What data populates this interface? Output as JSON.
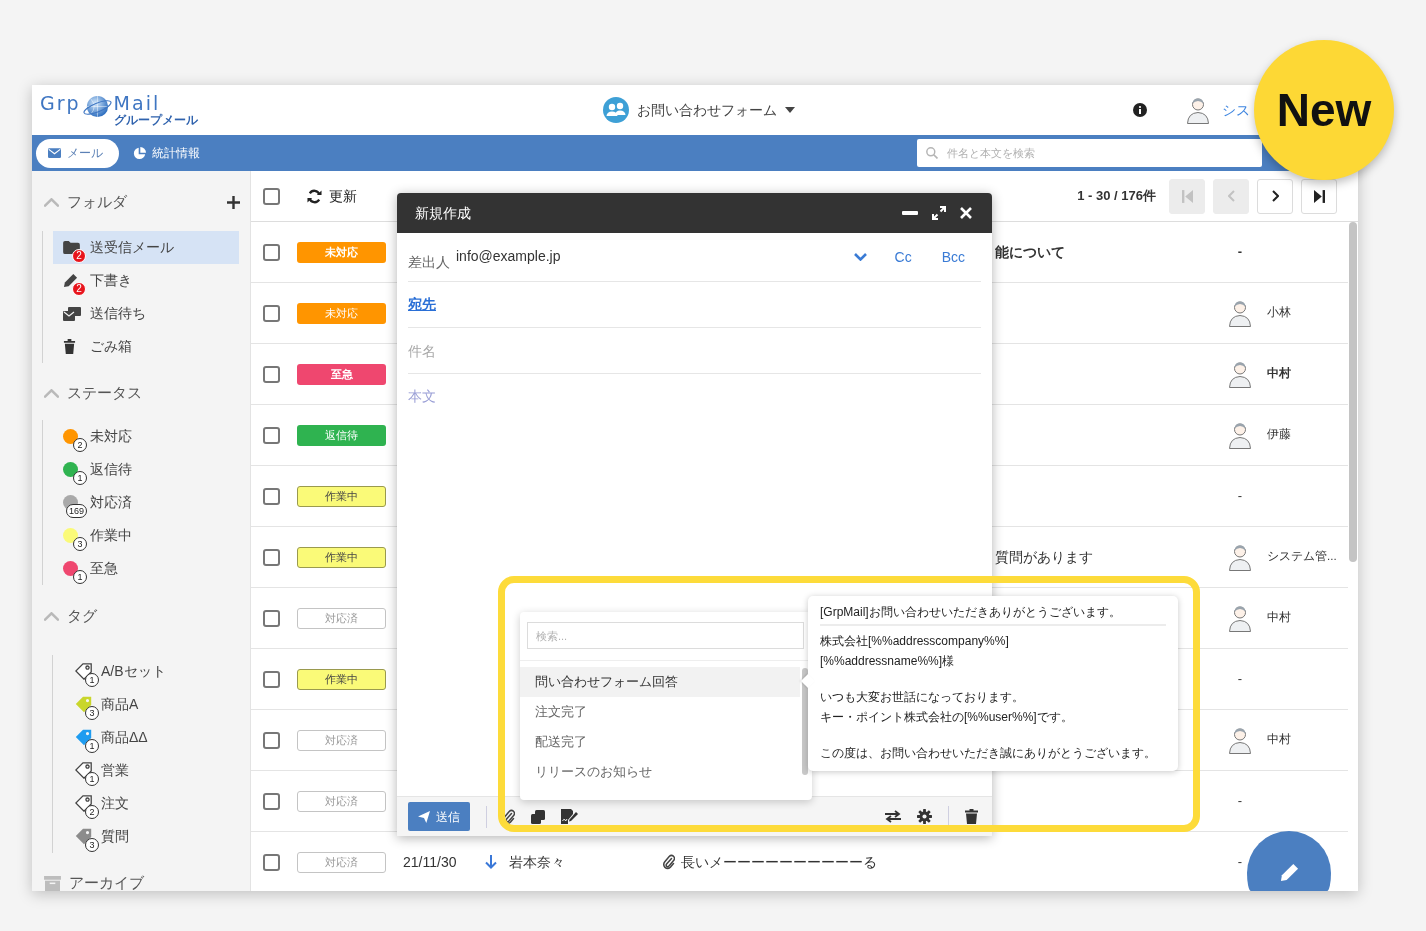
{
  "header": {
    "logo": {
      "left": "Grp",
      "right": "Mail",
      "subtitle": "グループメール"
    },
    "form_selector": {
      "label": "お問い合わせフォーム"
    },
    "user": {
      "name": "シス"
    }
  },
  "nav": {
    "tabs": [
      {
        "label": "メール",
        "kind": "mail",
        "selected": true
      },
      {
        "label": "統計情報",
        "kind": "stats",
        "selected": false
      }
    ],
    "search": {
      "placeholder": "件名と本文を検索"
    }
  },
  "sidebar": {
    "folders": {
      "title": "フォルダ",
      "expanded": true,
      "items": [
        {
          "label": "送受信メール",
          "kind": "inbox",
          "badge": "2",
          "selected": true
        },
        {
          "label": "下書き",
          "kind": "draft",
          "badge": "2",
          "selected": false
        },
        {
          "label": "送信待ち",
          "kind": "outbox",
          "selected": false
        },
        {
          "label": "ごみ箱",
          "kind": "trash",
          "selected": false
        }
      ]
    },
    "statuses": {
      "title": "ステータス",
      "expanded": true,
      "items": [
        {
          "label": "未対応",
          "color": "#ff9500",
          "count": "2",
          "selected": false
        },
        {
          "label": "返信待",
          "color": "#2fb350",
          "count": "1",
          "selected": false
        },
        {
          "label": "対応済",
          "color": "#a9a9a9",
          "count": "169",
          "selected": false
        },
        {
          "label": "作業中",
          "color": "#fafa78",
          "count": "3",
          "selected": false
        },
        {
          "label": "至急",
          "color": "#ef476f",
          "count": "1",
          "selected": false
        }
      ]
    },
    "tags": {
      "title": "タグ",
      "expanded": true,
      "items": [
        {
          "label": "A/Bセット",
          "color": "#ffffff",
          "count": "1",
          "selected": false
        },
        {
          "label": "商品A",
          "color": "#c9d62b",
          "count": "3",
          "selected": false
        },
        {
          "label": "商品ΔΔ",
          "color": "#1f9cf0",
          "count": "1",
          "selected": false
        },
        {
          "label": "営業",
          "color": "#ffffff",
          "count": "1",
          "selected": false
        },
        {
          "label": "注文",
          "color": "#ffffff",
          "count": "2",
          "selected": false
        },
        {
          "label": "質問",
          "color": "#8c8c8c",
          "count": "3",
          "selected": false
        }
      ]
    },
    "archive": {
      "label": "アーカイブ"
    }
  },
  "toolbar": {
    "select_all": {
      "checked": false
    },
    "refresh": {
      "label": "更新"
    },
    "pagination": {
      "range": "1 - 30 / 176件",
      "buttons": [
        {
          "kind": "first",
          "disabled": true
        },
        {
          "kind": "prev",
          "disabled": true
        },
        {
          "kind": "next",
          "disabled": false
        },
        {
          "kind": "last",
          "disabled": false
        }
      ]
    }
  },
  "rows": [
    {
      "checked": false,
      "unread": true,
      "status": {
        "label": "未対応",
        "color": "#ff9500"
      },
      "subject": "能について",
      "assignee": {
        "kind": "none",
        "name": "-"
      }
    },
    {
      "checked": false,
      "unread": false,
      "status": {
        "label": "未対応",
        "color": "#ff9500"
      },
      "assignee": {
        "kind": "person",
        "name": "小林"
      }
    },
    {
      "checked": false,
      "unread": true,
      "status": {
        "label": "至急",
        "color": "#ef476f"
      },
      "assignee": {
        "kind": "person",
        "name": "中村"
      }
    },
    {
      "checked": false,
      "unread": false,
      "status": {
        "label": "返信待",
        "color": "#2fb350"
      },
      "assignee": {
        "kind": "person",
        "name": "伊藤"
      }
    },
    {
      "checked": false,
      "unread": false,
      "status": {
        "label": "作業中",
        "color": "#fafa78"
      },
      "assignee": {
        "kind": "none",
        "name": "-"
      }
    },
    {
      "checked": false,
      "unread": false,
      "status": {
        "label": "作業中",
        "color": "#fafa78"
      },
      "subject": "質問があります",
      "assignee": {
        "kind": "person",
        "name": "システム管..."
      }
    },
    {
      "checked": false,
      "unread": false,
      "status": {
        "label": "対応済",
        "color": "#ffffff"
      },
      "assignee": {
        "kind": "person",
        "name": "中村"
      }
    },
    {
      "checked": false,
      "unread": false,
      "status": {
        "label": "作業中",
        "color": "#fafa78"
      },
      "assignee": {
        "kind": "none",
        "name": "-"
      }
    },
    {
      "checked": false,
      "unread": false,
      "status": {
        "label": "対応済",
        "color": "#ffffff"
      },
      "assignee": {
        "kind": "person",
        "name": "中村"
      }
    },
    {
      "checked": false,
      "unread": false,
      "status": {
        "label": "対応済",
        "color": "#ffffff"
      },
      "assignee": {
        "kind": "none",
        "name": "-"
      }
    },
    {
      "checked": false,
      "unread": false,
      "status": {
        "label": "対応済",
        "color": "#ffffff"
      },
      "date": "21/11/30",
      "received": true,
      "sender": "岩本奈々",
      "attachment": true,
      "subject": "長いメーーーーーーーーーーる",
      "assignee": {
        "kind": "none",
        "name": "-"
      }
    }
  ],
  "compose": {
    "title": "新規作成",
    "from": {
      "label": "差出人",
      "value": "info@example.jp"
    },
    "cc": "Cc",
    "bcc": "Bcc",
    "to": {
      "label": "宛先"
    },
    "subject": {
      "placeholder": "件名"
    },
    "body": {
      "placeholder": "本文"
    },
    "send": {
      "label": "送信"
    }
  },
  "template_picker": {
    "search": {
      "placeholder": "検索..."
    },
    "items": [
      {
        "label": "問い合わせフォーム回答",
        "selected": true
      },
      {
        "label": "注文完了",
        "selected": false
      },
      {
        "label": "配送完了",
        "selected": false
      },
      {
        "label": "リリースのお知らせ",
        "selected": false
      }
    ]
  },
  "template_preview": {
    "title": "[GrpMail]お問い合わせいただきありがとうございます。",
    "paragraphs": [
      [
        "株式会社[%%addresscompany%%]",
        "[%%addressname%%]様"
      ],
      [
        "いつも大変お世話になっております。",
        "キー・ポイント株式会社の[%%user%%]です。"
      ],
      [
        "この度は、お問い合わせいただき誠にありがとうございます。"
      ]
    ]
  },
  "new_badge": {
    "label": "New"
  }
}
